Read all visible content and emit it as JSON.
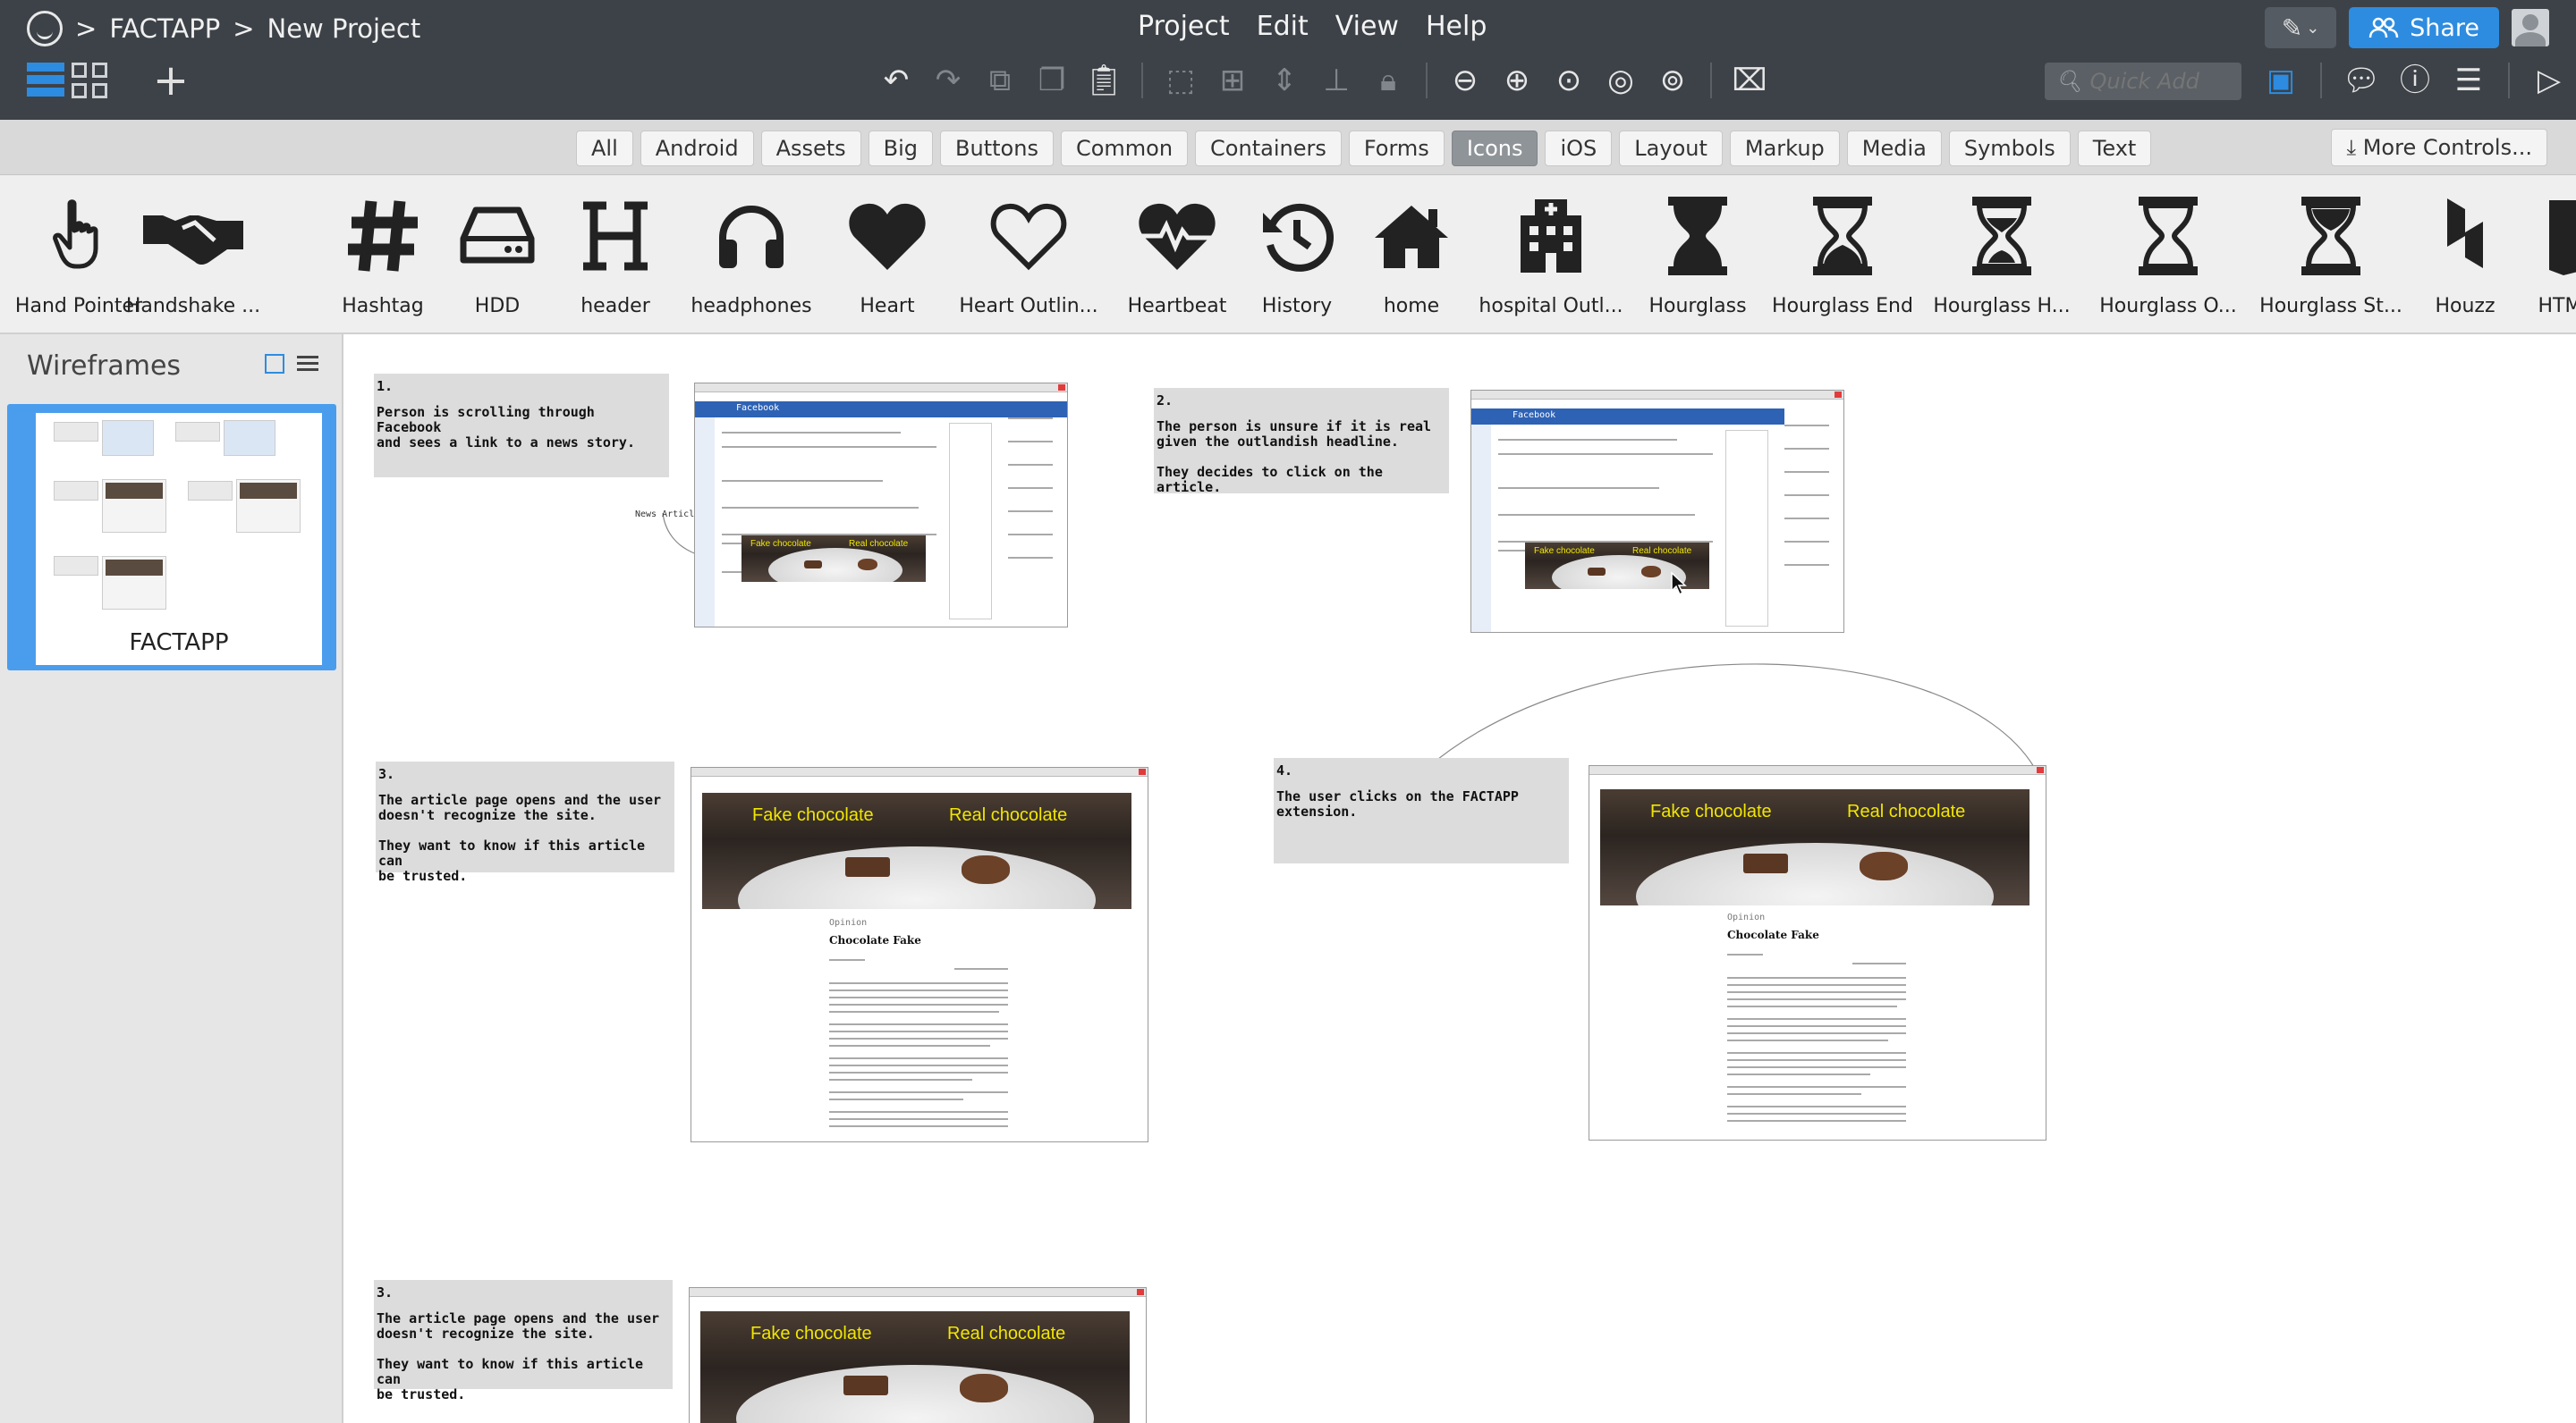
{
  "topbar": {
    "app_name": "FACTAPP",
    "separator": ">",
    "project_name": "New Project",
    "menus": [
      "Project",
      "Edit",
      "View",
      "Help"
    ],
    "share_label": "Share",
    "quick_add_placeholder": "Quick Add"
  },
  "library": {
    "categories": [
      "All",
      "Android",
      "Assets",
      "Big",
      "Buttons",
      "Common",
      "Containers",
      "Forms",
      "Icons",
      "iOS",
      "Layout",
      "Markup",
      "Media",
      "Symbols",
      "Text"
    ],
    "active_category": "Icons",
    "more_controls_label": "More Controls...",
    "icons": [
      {
        "label": "Hand Pointer",
        "icon": "hand-pointer-icon"
      },
      {
        "label": "Handshake ...",
        "icon": "handshake-icon"
      },
      {
        "label": "Hashtag",
        "icon": "hashtag-icon"
      },
      {
        "label": "HDD",
        "icon": "hdd-icon"
      },
      {
        "label": "header",
        "icon": "header-icon"
      },
      {
        "label": "headphones",
        "icon": "headphones-icon"
      },
      {
        "label": "Heart",
        "icon": "heart-icon"
      },
      {
        "label": "Heart Outlin...",
        "icon": "heart-outline-icon"
      },
      {
        "label": "Heartbeat",
        "icon": "heartbeat-icon"
      },
      {
        "label": "History",
        "icon": "history-icon"
      },
      {
        "label": "home",
        "icon": "home-icon"
      },
      {
        "label": "hospital Outl...",
        "icon": "hospital-outline-icon"
      },
      {
        "label": "Hourglass",
        "icon": "hourglass-icon"
      },
      {
        "label": "Hourglass End",
        "icon": "hourglass-end-icon"
      },
      {
        "label": "Hourglass H...",
        "icon": "hourglass-half-icon"
      },
      {
        "label": "Hourglass O...",
        "icon": "hourglass-outline-icon"
      },
      {
        "label": "Hourglass St...",
        "icon": "hourglass-start-icon"
      },
      {
        "label": "Houzz",
        "icon": "houzz-icon"
      },
      {
        "label": "HTM",
        "icon": "html5-icon"
      }
    ]
  },
  "sidebar": {
    "title": "Wireframes",
    "wireframe_name": "FACTAPP"
  },
  "canvas": {
    "notes": [
      {
        "number": "1.",
        "text": "Person is scrolling through Facebook\nand sees a link to a news story."
      },
      {
        "number": "2.",
        "text": "The person is unsure if it is real\ngiven the outlandish headline.\n\nThey decides to click on the article."
      },
      {
        "number": "3.",
        "text": "The article page opens and the user\ndoesn't recognize the site.\n\nThey want to know if this article can\nbe trusted."
      },
      {
        "number": "4.",
        "text": "The user clicks on the FACTAPP\nextension."
      },
      {
        "number": "3.",
        "text": "The article page opens and the user\ndoesn't recognize the site.\n\nThey want to know if this article can\nbe trusted."
      }
    ],
    "connector_label": "News Article",
    "frames": [
      {
        "facebook_label": "Facebook",
        "caption_fake": "Fake chocolate",
        "caption_real": "Real chocolate"
      },
      {
        "facebook_label": "Facebook",
        "caption_fake": "Fake chocolate",
        "caption_real": "Real chocolate"
      },
      {
        "caption_fake": "Fake chocolate",
        "caption_real": "Real chocolate",
        "section": "Opinion",
        "title": "Chocolate Fake"
      },
      {
        "caption_fake": "Fake chocolate",
        "caption_real": "Real chocolate",
        "section": "Opinion",
        "title": "Chocolate Fake"
      },
      {
        "caption_fake": "Fake chocolate",
        "caption_real": "Real chocolate"
      }
    ]
  },
  "colors": {
    "topbar_bg": "#3d4248",
    "accent": "#2d8ce0",
    "library_bg": "#d9d9d9",
    "canvas_note_bg": "#dcdcdc",
    "caption_yellow": "#f1e600"
  }
}
